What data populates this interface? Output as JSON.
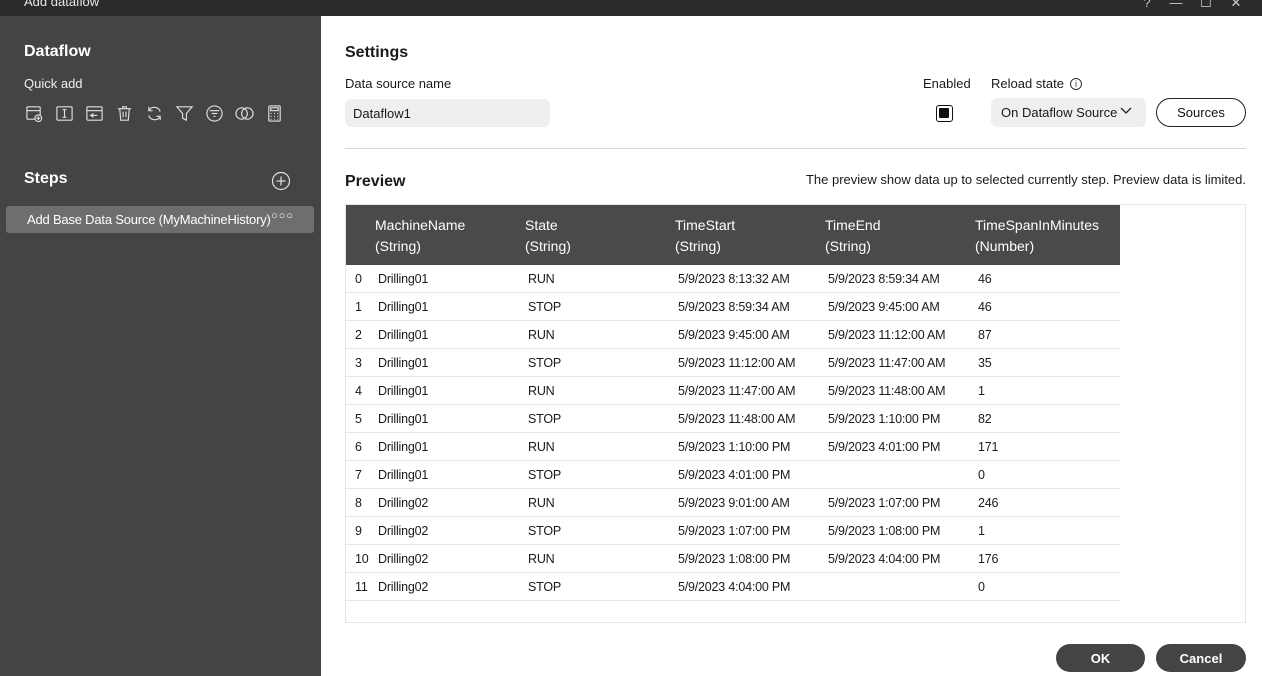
{
  "window": {
    "title": "Add dataflow",
    "controls": [
      "?",
      "—",
      "☐",
      "✕"
    ]
  },
  "sidebar": {
    "heading": "Dataflow",
    "quick_add_label": "Quick add",
    "quick_add_icons": [
      "add-table-icon",
      "text-cursor-icon",
      "import-icon",
      "trash-icon",
      "refresh-icon",
      "filter-icon",
      "filter-list-icon",
      "join-icon",
      "calculator-icon"
    ],
    "steps_label": "Steps",
    "steps": [
      {
        "label": "Add Base Data Source (MyMachineHistory)",
        "more": "○○○"
      }
    ]
  },
  "settings": {
    "heading": "Settings",
    "data_source_name_label": "Data source name",
    "data_source_name_value": "Dataflow1",
    "enabled_label": "Enabled",
    "enabled": true,
    "reload_state_label": "Reload state",
    "reload_state_value": "On Dataflow Source",
    "sources_button": "Sources"
  },
  "preview": {
    "heading": "Preview",
    "note": "The preview show data up to selected currently step. Preview data is limited.",
    "columns": [
      {
        "name": "MachineName",
        "type": "(String)"
      },
      {
        "name": "State",
        "type": "(String)"
      },
      {
        "name": "TimeStart",
        "type": "(String)"
      },
      {
        "name": "TimeEnd",
        "type": "(String)"
      },
      {
        "name": "TimeSpanInMinutes",
        "type": "(Number)"
      }
    ],
    "rows": [
      [
        "0",
        "Drilling01",
        "RUN",
        "5/9/2023 8:13:32 AM",
        "5/9/2023 8:59:34 AM",
        "46"
      ],
      [
        "1",
        "Drilling01",
        "STOP",
        "5/9/2023 8:59:34 AM",
        "5/9/2023 9:45:00 AM",
        "46"
      ],
      [
        "2",
        "Drilling01",
        "RUN",
        "5/9/2023 9:45:00 AM",
        "5/9/2023 11:12:00 AM",
        "87"
      ],
      [
        "3",
        "Drilling01",
        "STOP",
        "5/9/2023 11:12:00 AM",
        "5/9/2023 11:47:00 AM",
        "35"
      ],
      [
        "4",
        "Drilling01",
        "RUN",
        "5/9/2023 11:47:00 AM",
        "5/9/2023 11:48:00 AM",
        "1"
      ],
      [
        "5",
        "Drilling01",
        "STOP",
        "5/9/2023 11:48:00 AM",
        "5/9/2023 1:10:00 PM",
        "82"
      ],
      [
        "6",
        "Drilling01",
        "RUN",
        "5/9/2023 1:10:00 PM",
        "5/9/2023 4:01:00 PM",
        "171"
      ],
      [
        "7",
        "Drilling01",
        "STOP",
        "5/9/2023 4:01:00 PM",
        "",
        "0"
      ],
      [
        "8",
        "Drilling02",
        "RUN",
        "5/9/2023 9:01:00 AM",
        "5/9/2023 1:07:00 PM",
        "246"
      ],
      [
        "9",
        "Drilling02",
        "STOP",
        "5/9/2023 1:07:00 PM",
        "5/9/2023 1:08:00 PM",
        "1"
      ],
      [
        "10",
        "Drilling02",
        "RUN",
        "5/9/2023 1:08:00 PM",
        "5/9/2023 4:04:00 PM",
        "176"
      ],
      [
        "11",
        "Drilling02",
        "STOP",
        "5/9/2023 4:04:00 PM",
        "",
        "0"
      ]
    ]
  },
  "footer": {
    "ok_button": "OK",
    "cancel_button": "Cancel"
  }
}
